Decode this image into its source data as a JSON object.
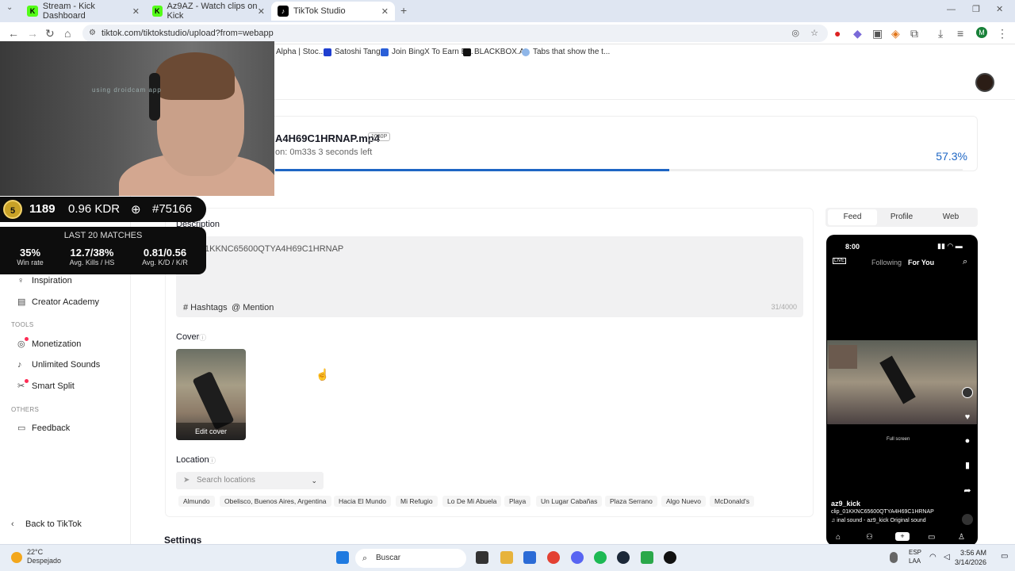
{
  "browser": {
    "tabs": [
      {
        "label": "Stream - Kick Dashboard",
        "color": "#53fc18"
      },
      {
        "label": "Az9AZ - Watch clips on Kick",
        "color": "#53fc18"
      },
      {
        "label": "TikTok Studio",
        "color": "#000000"
      }
    ],
    "new_tab": "+",
    "url": "tiktok.com/tiktokstudio/upload?from=webapp",
    "bookmarks": [
      "Alpha | Stoc...",
      "Satoshi Tango",
      "Join BingX To Earn B...",
      "BLACKBOX.AI",
      "Tabs that show the t..."
    ],
    "profile_initial": "M"
  },
  "upload": {
    "file_name": "A4H69C1HRNAP.mp4",
    "badge": "1080P",
    "time_left": "on: 0m33s  3 seconds left",
    "progress_percent": "57.3%",
    "progress": 0.573
  },
  "details": {
    "description_label": "Description",
    "description_text": "1KKNC65600QTYA4H69C1HRNAP",
    "hashtags": "# Hashtags",
    "mention": "@ Mention",
    "char_count": "31/4000",
    "cover_label": "Cover",
    "edit_cover": "Edit cover",
    "location_label": "Location",
    "location_placeholder": "Search locations",
    "location_chips": [
      "Almundo",
      "Obelisco, Buenos Aires, Argentina",
      "Hacia El Mundo",
      "Mi Refugio",
      "Lo De Mi Abuela",
      "Playa",
      "Un Lugar Cabañas",
      "Plaza Serrano",
      "Algo Nuevo",
      "McDonald's"
    ],
    "settings_label": "Settings"
  },
  "sidebar": {
    "items_top": [
      {
        "label": "Inspiration",
        "icon": "lightbulb-icon"
      },
      {
        "label": "Creator Academy",
        "icon": "book-icon"
      }
    ],
    "tools_heading": "TOOLS",
    "tools": [
      {
        "label": "Monetization",
        "icon": "coin-icon",
        "dot": true
      },
      {
        "label": "Unlimited Sounds",
        "icon": "music-icon",
        "dot": false
      },
      {
        "label": "Smart Split",
        "icon": "scissors-icon",
        "dot": true
      }
    ],
    "others_heading": "OTHERS",
    "feedback": "Feedback",
    "back": "Back to TikTok"
  },
  "preview": {
    "tabs": [
      "Feed",
      "Profile",
      "Web"
    ],
    "selected_tab": "Feed",
    "time": "8:00",
    "following": "Following",
    "for_you": "For You",
    "live": "LIVE",
    "fullscreen": "Full screen",
    "username": "az9_kick",
    "caption": "clip_01KKNC65600QTYA4H69C1HRNAP",
    "sound": "♫ inal sound - az9_kick   Original sound"
  },
  "overlay": {
    "watermark": "using droidcam app",
    "coin_level": "5",
    "elo": "1189",
    "kdr": "0.96 KDR",
    "rank": "#75166",
    "last_matches_title": "LAST 20 MATCHES",
    "stats": [
      {
        "value": "35%",
        "key": "Win rate"
      },
      {
        "value": "12.7/38%",
        "key": "Avg. Kills / HS"
      },
      {
        "value": "0.81/0.56",
        "key": "Avg. K/D / K/R"
      }
    ]
  },
  "taskbar": {
    "temperature": "22°C",
    "weather": "Despejado",
    "search": "Buscar",
    "lang_top": "ESP",
    "lang_bottom": "LAA",
    "time": "3:56 AM",
    "date": "3/14/2026"
  }
}
